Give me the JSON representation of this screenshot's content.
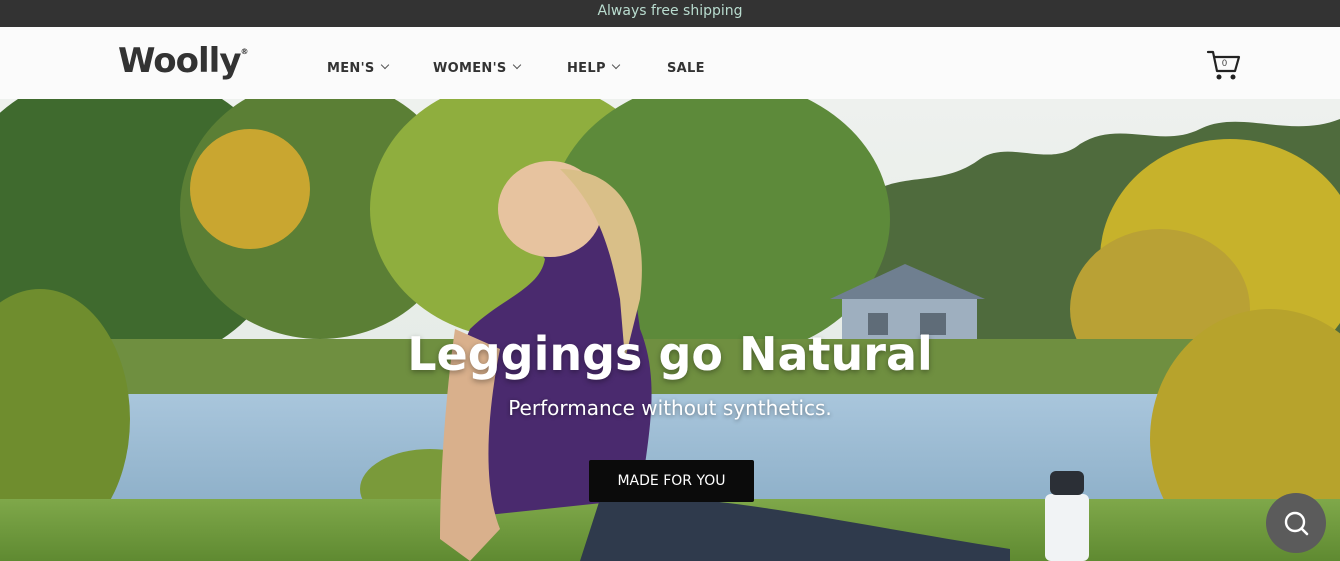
{
  "announcement": {
    "text": "Always free shipping"
  },
  "brand": {
    "logo": "Woolly",
    "reg": "®"
  },
  "nav": [
    {
      "label": "MEN'S",
      "has_dropdown": true
    },
    {
      "label": "WOMEN'S",
      "has_dropdown": true
    },
    {
      "label": "HELP",
      "has_dropdown": true
    },
    {
      "label": "SALE",
      "has_dropdown": false
    }
  ],
  "cart": {
    "count": "0",
    "icon": "cart-icon"
  },
  "hero": {
    "title": "Leggings go Natural",
    "subtitle": "Performance without synthetics.",
    "button_label": "MADE FOR YOU"
  },
  "search_fab": {
    "icon": "search-icon"
  },
  "colors": {
    "announcement_bg": "#333333",
    "announcement_text": "#b9dccf",
    "header_bg": "#fbfbfb",
    "button_bg": "#0b0b0b",
    "fab_bg": "#5b5b5b"
  }
}
